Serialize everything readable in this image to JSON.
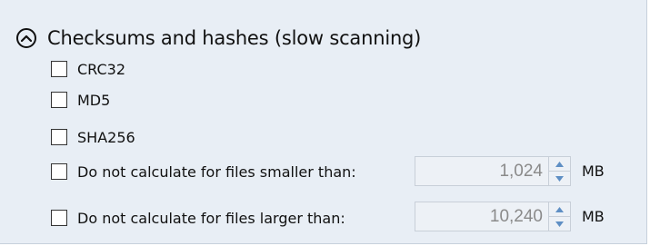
{
  "section": {
    "title": "Checksums and hashes (slow scanning)",
    "expanded": true,
    "toggle_icon": "chevron-up-icon"
  },
  "options": [
    {
      "label": "CRC32",
      "checked": false
    },
    {
      "label": "MD5",
      "checked": false
    },
    {
      "label": "SHA256",
      "checked": false
    }
  ],
  "limits": {
    "smaller": {
      "label": "Do not calculate for files smaller than:",
      "checked": false,
      "value": "1,024",
      "unit": "MB"
    },
    "larger": {
      "label": "Do not calculate for files larger than:",
      "checked": false,
      "value": "10,240",
      "unit": "MB"
    }
  },
  "colors": {
    "panel_background": "#e8eef5",
    "field_background": "#edf1f6",
    "disabled_text": "#8a8a8a"
  }
}
